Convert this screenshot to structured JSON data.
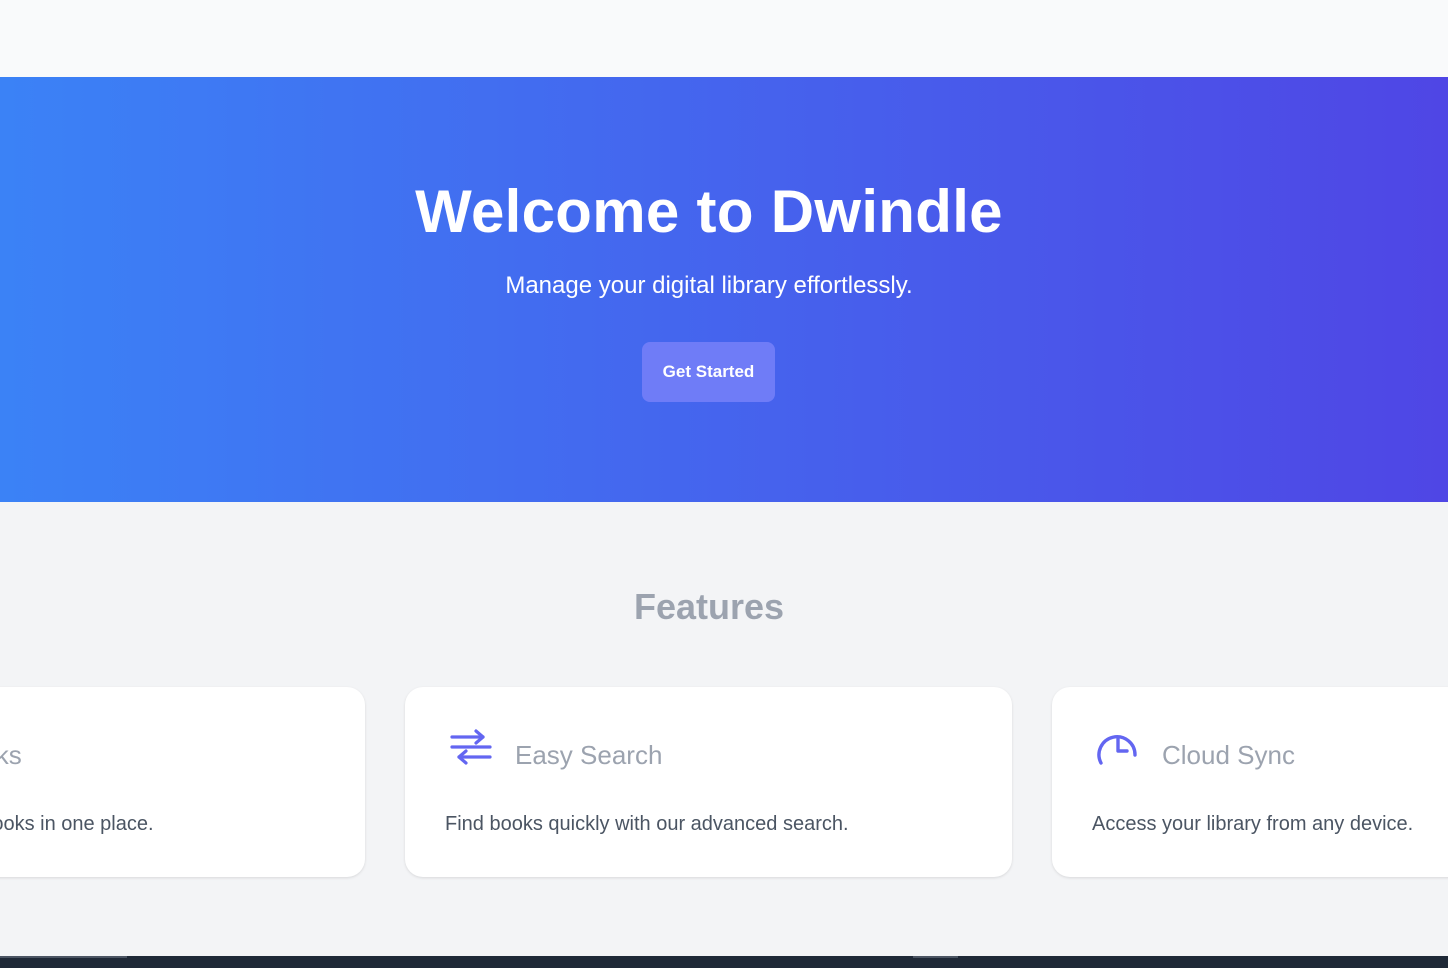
{
  "hero": {
    "title": "Welcome to Dwindle",
    "subtitle": "Manage your digital library effortlessly.",
    "cta_label": "Get Started"
  },
  "features": {
    "title": "Features",
    "cards": [
      {
        "title": "Digital Books",
        "description": "Store all your digital books in one place.",
        "icon": "book-icon"
      },
      {
        "title": "Easy Search",
        "description": "Find books quickly with our advanced search.",
        "icon": "filter-arrows-icon"
      },
      {
        "title": "Cloud Sync",
        "description": "Access your library from any device.",
        "icon": "clock-icon"
      }
    ]
  },
  "colors": {
    "hero_gradient_start": "#3b82f6",
    "hero_gradient_end": "#4f46e5",
    "cta_background": "#6f7cf7",
    "icon_accent": "#6366f1"
  }
}
